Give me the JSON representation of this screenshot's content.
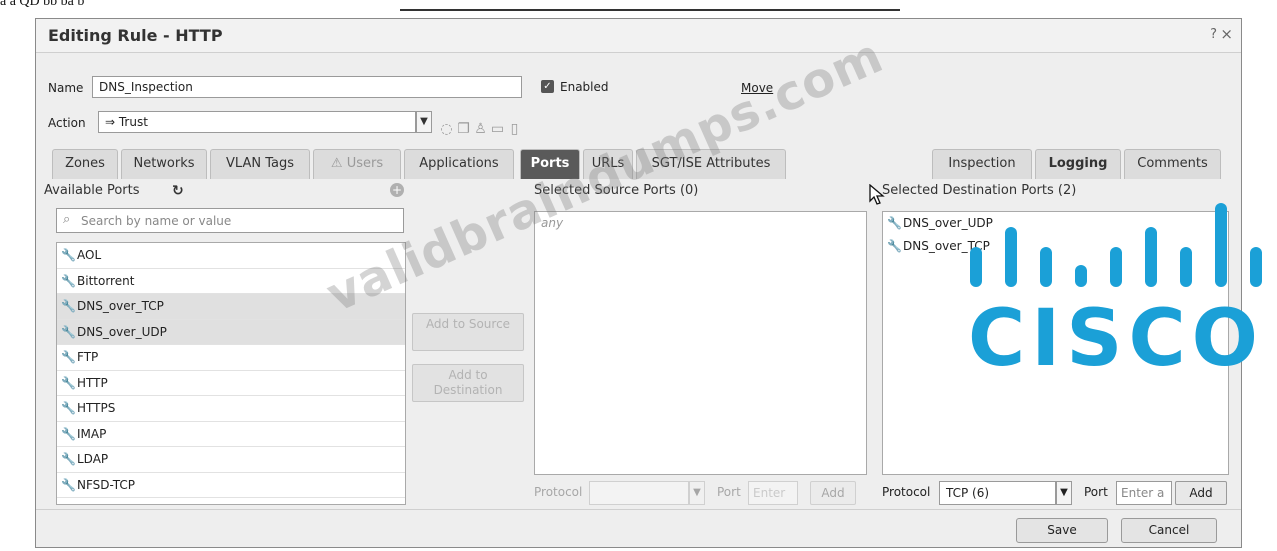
{
  "dialog": {
    "title": "Editing Rule - HTTP",
    "help_icon": "?",
    "close_icon": "×"
  },
  "rule": {
    "name_label": "Name",
    "name_value": "DNS_Inspection",
    "enabled_label": "Enabled",
    "enabled_checked": true,
    "move_link": "Move",
    "action_label": "Action",
    "action_value": "⇒ Trust",
    "action_icons": [
      "shield-icon",
      "copy-icon",
      "users-icon",
      "folder-icon",
      "document-icon"
    ]
  },
  "tabs": [
    {
      "label": "Zones"
    },
    {
      "label": "Networks"
    },
    {
      "label": "VLAN Tags"
    },
    {
      "label": "Users",
      "icon": "warning-icon",
      "disabled": true
    },
    {
      "label": "Applications"
    },
    {
      "label": "Ports",
      "active": true
    },
    {
      "label": "URLs"
    },
    {
      "label": "SGT/ISE Attributes"
    },
    {
      "label": "Inspection"
    },
    {
      "label": "Logging",
      "bold": true
    },
    {
      "label": "Comments"
    }
  ],
  "available": {
    "heading": "Available Ports",
    "search_placeholder": "Search by name or value",
    "items": [
      "AOL",
      "Bittorrent",
      "DNS_over_TCP",
      "DNS_over_UDP",
      "FTP",
      "HTTP",
      "HTTPS",
      "IMAP",
      "LDAP",
      "NFSD-TCP"
    ],
    "selected_items": [
      "DNS_over_TCP",
      "DNS_over_UDP"
    ]
  },
  "buttons": {
    "add_to_source": "Add to Source",
    "add_to_destination": "Add to Destination",
    "save": "Save",
    "cancel": "Cancel"
  },
  "source": {
    "heading": "Selected Source Ports (0)",
    "empty_text": "any",
    "protocol_label": "Protocol",
    "port_label": "Port",
    "port_placeholder": "Enter",
    "add_label": "Add"
  },
  "destination": {
    "heading": "Selected Destination Ports (2)",
    "items": [
      "DNS_over_UDP",
      "DNS_over_TCP"
    ],
    "protocol_label": "Protocol",
    "protocol_value": "TCP (6)",
    "port_label": "Port",
    "port_placeholder": "Enter a",
    "add_label": "Add"
  },
  "overlays": {
    "watermark": "validbraindumps.com",
    "logo_word": "CISCO"
  },
  "colors": {
    "active_tab": "#5a5a5a",
    "logo_blue": "#1ba0d7"
  }
}
